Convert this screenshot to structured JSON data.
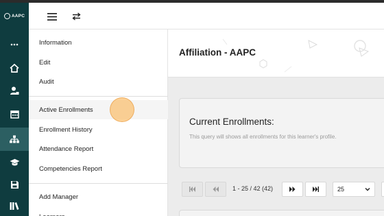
{
  "app": {
    "logo_text": "AAPC"
  },
  "rail": {
    "icons": [
      "more-icon",
      "home-icon",
      "learner-icon",
      "calendar-icon",
      "org-chart-icon",
      "graduation-cap-icon",
      "save-icon",
      "library-icon"
    ],
    "active": "org-chart-icon"
  },
  "header": {
    "menu_icon": "hamburger-icon",
    "switch_icon": "swap-arrows-icon"
  },
  "submenu": {
    "group1": [
      "Information",
      "Edit",
      "Audit"
    ],
    "group2": [
      "Active Enrollments",
      "Enrollment History",
      "Attendance Report",
      "Competencies Report"
    ],
    "group3": [
      "Add Manager",
      "Learners"
    ]
  },
  "main": {
    "title": "Affiliation - AAPC",
    "card": {
      "heading": "Current Enrollments:",
      "description": "This query will shows all enrollments for this learner's profile."
    },
    "pager": {
      "range_text": "1 - 25 / 42 (42)",
      "page_size": "25"
    }
  },
  "colors": {
    "rail_bg": "#0f3c3f",
    "rail_active": "#2c5f62",
    "cursor": "#fab85e"
  }
}
